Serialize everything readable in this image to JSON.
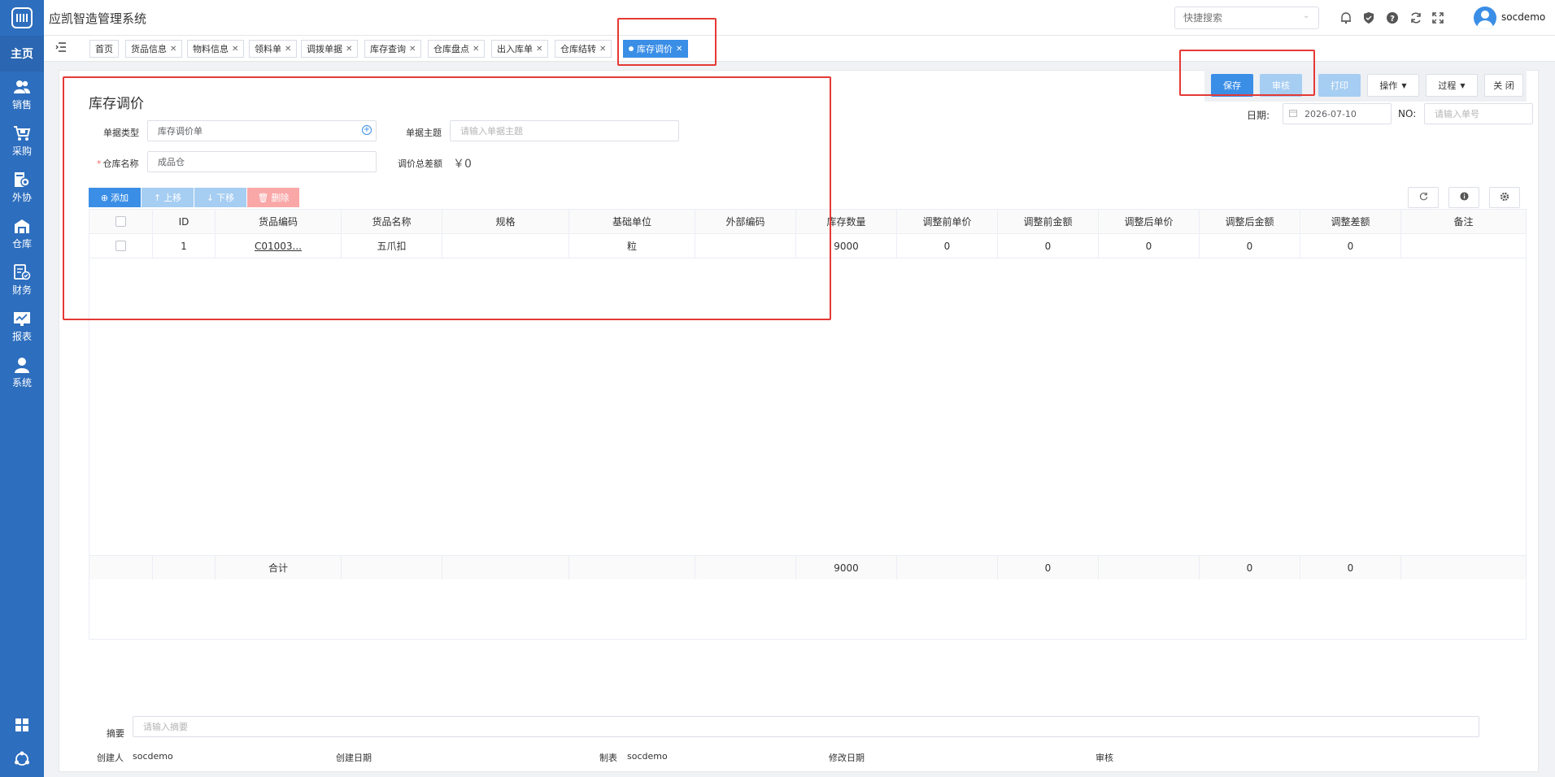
{
  "app": {
    "title": "应凯智造管理系统",
    "username": "socdemo"
  },
  "search": {
    "placeholder": "快捷搜索"
  },
  "sidebar": {
    "home": "主页",
    "items": [
      {
        "label": "销售",
        "icon": "users-icon"
      },
      {
        "label": "采购",
        "icon": "cart-icon"
      },
      {
        "label": "外协",
        "icon": "outsource-icon"
      },
      {
        "label": "仓库",
        "icon": "warehouse-icon"
      },
      {
        "label": "财务",
        "icon": "finance-icon"
      },
      {
        "label": "报表",
        "icon": "chart-icon"
      },
      {
        "label": "系统",
        "icon": "user-icon"
      }
    ]
  },
  "tabs": [
    {
      "label": "首页",
      "closable": false
    },
    {
      "label": "货品信息",
      "closable": true
    },
    {
      "label": "物料信息",
      "closable": true
    },
    {
      "label": "领料单",
      "closable": true
    },
    {
      "label": "调拨单据",
      "closable": true
    },
    {
      "label": "库存查询",
      "closable": true
    },
    {
      "label": "仓库盘点",
      "closable": true
    },
    {
      "label": "出入库单",
      "closable": true
    },
    {
      "label": "仓库结转",
      "closable": true
    },
    {
      "label": "库存调价",
      "closable": true,
      "active": true
    }
  ],
  "page": {
    "title": "库存调价"
  },
  "form": {
    "doc_type_label": "单据类型",
    "doc_type_value": "库存调价单",
    "subject_label": "单据主题",
    "subject_placeholder": "请输入单据主题",
    "warehouse_label": "仓库名称",
    "warehouse_value": "成品仓",
    "diff_label": "调价总差额",
    "diff_value": "￥0",
    "date_label": "日期:",
    "date_value": "2026-07-10",
    "no_label": "NO:",
    "no_placeholder": "请输入单号"
  },
  "actions": {
    "save": "保存",
    "audit": "审核",
    "print": "打印",
    "operate": "操作",
    "process": "过程",
    "close": "关 闭"
  },
  "toolbar": {
    "add": "添加",
    "up": "上移",
    "down": "下移",
    "delete": "删除"
  },
  "table": {
    "columns": [
      "ID",
      "货品编码",
      "货品名称",
      "规格",
      "基础单位",
      "外部编码",
      "库存数量",
      "调整前单价",
      "调整前金额",
      "调整后单价",
      "调整后金额",
      "调整差额",
      "备注"
    ],
    "rows": [
      [
        "1",
        "C01003...",
        "五爪扣",
        "",
        "粒",
        "",
        "9000",
        "0",
        "0",
        "0",
        "0",
        "0",
        ""
      ]
    ],
    "total_label": "合计",
    "totals": [
      "",
      "",
      "",
      "",
      "",
      "9000",
      "",
      "0",
      "",
      "0",
      "0",
      ""
    ]
  },
  "summary": {
    "memo_label": "摘要",
    "memo_placeholder": "请输入摘要",
    "creator_label": "创建人",
    "creator_value": "socdemo",
    "created_date_label": "创建日期",
    "maker_label": "制表",
    "maker_value": "socdemo",
    "modified_date_label": "修改日期",
    "audit_label": "审核"
  },
  "colors": {
    "primary": "#3a8ee6",
    "sidebar": "#2d6ebe",
    "annotation": "#e53935",
    "danger_light": "#f9a7a7"
  }
}
